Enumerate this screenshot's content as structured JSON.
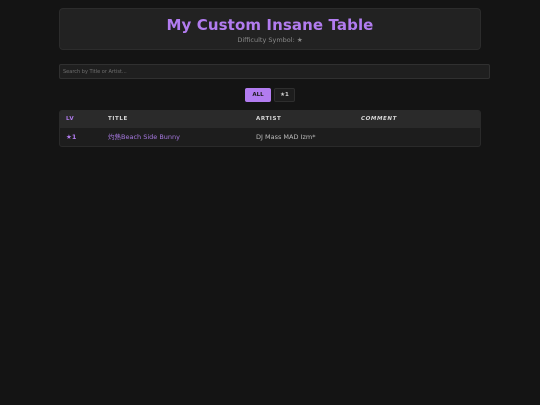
{
  "header": {
    "title": "My Custom Insane Table",
    "subtitle": "Difficulty Symbol: ★"
  },
  "search": {
    "placeholder": "Search by Title or Artist...",
    "value": ""
  },
  "filters": {
    "items": [
      {
        "label": "ALL",
        "active": true
      },
      {
        "label": "★1",
        "active": false
      }
    ]
  },
  "table": {
    "columns": {
      "lv": "LV",
      "title": "TITLE",
      "artist": "ARTIST",
      "comment": "COMMENT"
    },
    "rows": [
      {
        "lv": "★1",
        "title": "灼熱Beach Side Bunny",
        "artist": "DJ Mass MAD Izm*",
        "comment": ""
      }
    ]
  },
  "colors": {
    "accent": "#b27cf0",
    "background": "#141414",
    "panel": "#222222",
    "text_muted": "#8a8a8a"
  }
}
